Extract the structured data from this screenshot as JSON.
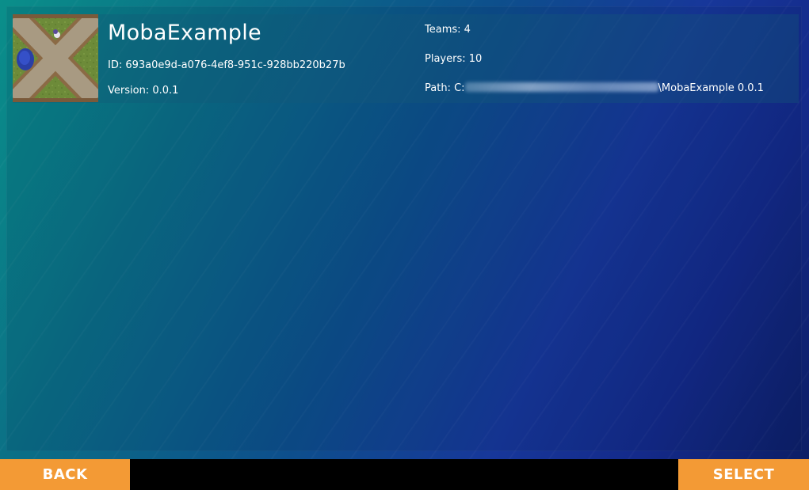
{
  "game": {
    "title": "MobaExample",
    "id_text": "ID: 693a0e9d-a076-4ef8-951c-928bb220b27b",
    "version_text": "Version: 0.0.1",
    "teams_text": "Teams: 4",
    "players_text": "Players: 10",
    "path_prefix": "Path: C:",
    "path_suffix": "\\MobaExample 0.0.1",
    "thumbnail_icon": "moba-map-thumbnail-icon"
  },
  "footer": {
    "back_label": "BACK",
    "select_label": "SELECT"
  },
  "colors": {
    "button": "#f39a35",
    "bar": "#000000",
    "background_start": "#0a8f8a",
    "background_end": "#0c1d62"
  }
}
